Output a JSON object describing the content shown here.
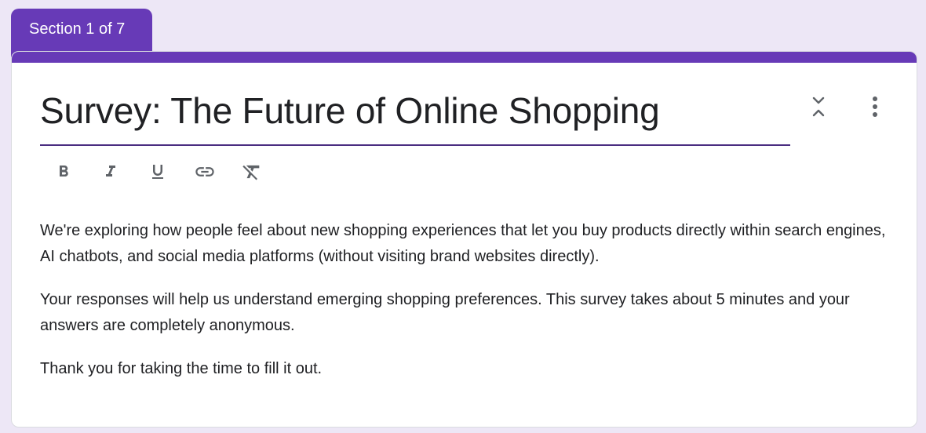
{
  "section_tab": {
    "label": "Section 1 of 7"
  },
  "form": {
    "title": "Survey: The Future of Online Shopping",
    "description": [
      "We're exploring how people feel about new shopping experiences that let you buy products directly within search engines, AI chatbots, and social media platforms (without visiting brand websites directly).",
      "Your responses will help us understand emerging shopping preferences. This survey takes about 5 minutes and your answers are completely anonymous.",
      "Thank you for taking the time to fill it out."
    ]
  },
  "toolbar": {
    "buttons": [
      "bold-icon",
      "italic-icon",
      "underline-icon",
      "link-icon",
      "clear-format-icon"
    ]
  },
  "header_actions": {
    "icons": [
      "collapse-icon",
      "more-vert-icon"
    ]
  },
  "colors": {
    "accent": "#673ab7",
    "background": "#ede7f6",
    "underline": "#4a2d80",
    "icon": "#5f6368",
    "text": "#202124"
  }
}
